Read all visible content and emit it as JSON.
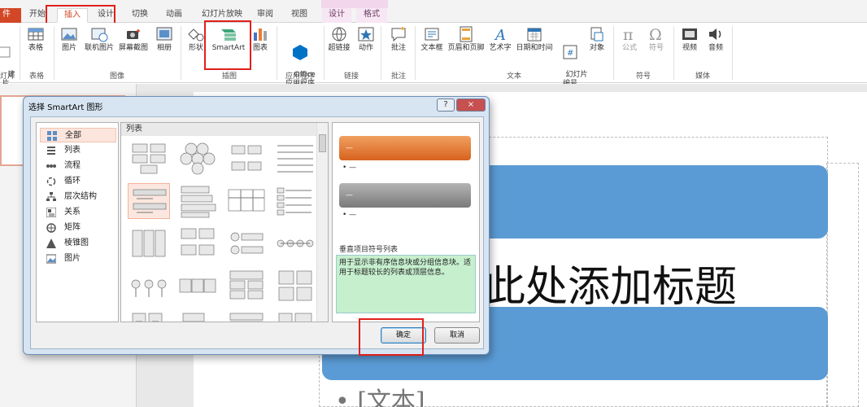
{
  "ribbon_tabs": {
    "file": "件",
    "start": "开始",
    "insert": "插入",
    "design": "设计",
    "transitions": "切换",
    "animations": "动画",
    "slideshow": "幻灯片放映",
    "review": "审阅",
    "view": "视图",
    "ctx_design": "设计",
    "ctx_format": "格式"
  },
  "ribbon": {
    "new_slide": "建\n片",
    "table": "表格",
    "picture": "图片",
    "online_picture": "联机图片",
    "screenshot": "屏幕截图",
    "album": "相册",
    "shapes": "形状",
    "smartart": "SmartArt",
    "chart": "图表",
    "office_apps": "Office\n应用程序",
    "hyperlink": "超链接",
    "action": "动作",
    "comment": "批注",
    "textbox": "文本框",
    "header_footer": "页眉和页脚",
    "wordart": "艺术字",
    "datetime": "日期和时间",
    "slide_number": "幻灯片\n编号",
    "object": "对象",
    "equation": "公式",
    "symbol": "符号",
    "video": "视频",
    "audio": "音频",
    "groups": {
      "slides": "灯片",
      "tables": "表格",
      "images": "图像",
      "illustrations": "插图",
      "apps": "应用程序",
      "links": "链接",
      "comments": "批注",
      "text": "文本",
      "symbols": "符号",
      "media": "媒体"
    }
  },
  "slide": {
    "title_placeholder": "此处添加标题",
    "bullet_text": "• [文本]"
  },
  "dialog": {
    "title": "选择 SmartArt 图形",
    "help": "?",
    "close": "×",
    "categories": [
      "全部",
      "列表",
      "流程",
      "循环",
      "层次结构",
      "关系",
      "矩阵",
      "棱锥图",
      "图片"
    ],
    "selected_category": "全部",
    "layout_header": "列表",
    "preview_dash": "—",
    "preview_bullet": "• —",
    "layout_name": "垂直项目符号列表",
    "layout_description": "用于显示非有序信息块或分组信息块。适用于标题较长的列表或顶层信息。",
    "ok": "确定",
    "cancel": "取消"
  },
  "colors": {
    "accent_red": "#d24726",
    "highlight": "#e0201b",
    "smartart_blue": "#5b9bd5",
    "preview_orange": "#e0762a",
    "preview_gray": "#8a8a8a",
    "desc_green": "#c6efce"
  }
}
